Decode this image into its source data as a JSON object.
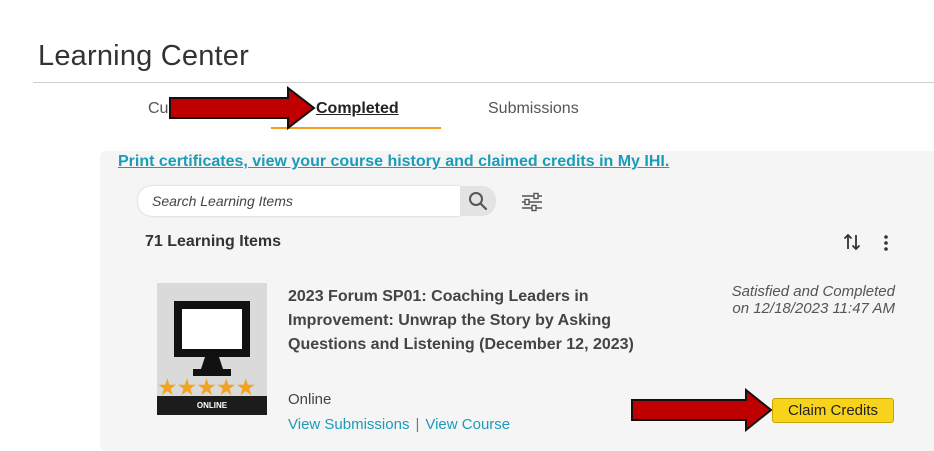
{
  "page": {
    "title": "Learning Center"
  },
  "tabs": {
    "current": "Cu",
    "completed": "Completed",
    "submissions": "Submissions"
  },
  "print_link": "Print certificates, view your course history and claimed credits in My IHI.",
  "search": {
    "placeholder": "Search Learning Items"
  },
  "toolbar": {
    "count": "71 Learning Items"
  },
  "item": {
    "title": "2023 Forum SP01: Coaching Leaders in Improvement: Unwrap the Story by Asking Questions and Listening (December 12, 2023)",
    "format": "Online",
    "format_badge": "ONLINE",
    "stars": "★★★★★",
    "status": "Satisfied and Completed on 12/18/2023 11:47 AM",
    "view_submissions": "View Submissions",
    "separator": "|",
    "view_course": "View Course",
    "claim_label": "Claim Credits"
  },
  "colors": {
    "accent_link": "#1a9cb8",
    "tab_underline": "#f0a020",
    "claim_button": "#f8d31c",
    "annotation_arrow": "#c00000",
    "star": "#f2a41f"
  },
  "icons": {
    "search": "search-icon",
    "filter": "filter-sliders-icon",
    "sort": "sort-icon",
    "more": "more-vertical-icon",
    "thumbnail": "monitor-icon",
    "annotation": "red-arrow-icon"
  }
}
